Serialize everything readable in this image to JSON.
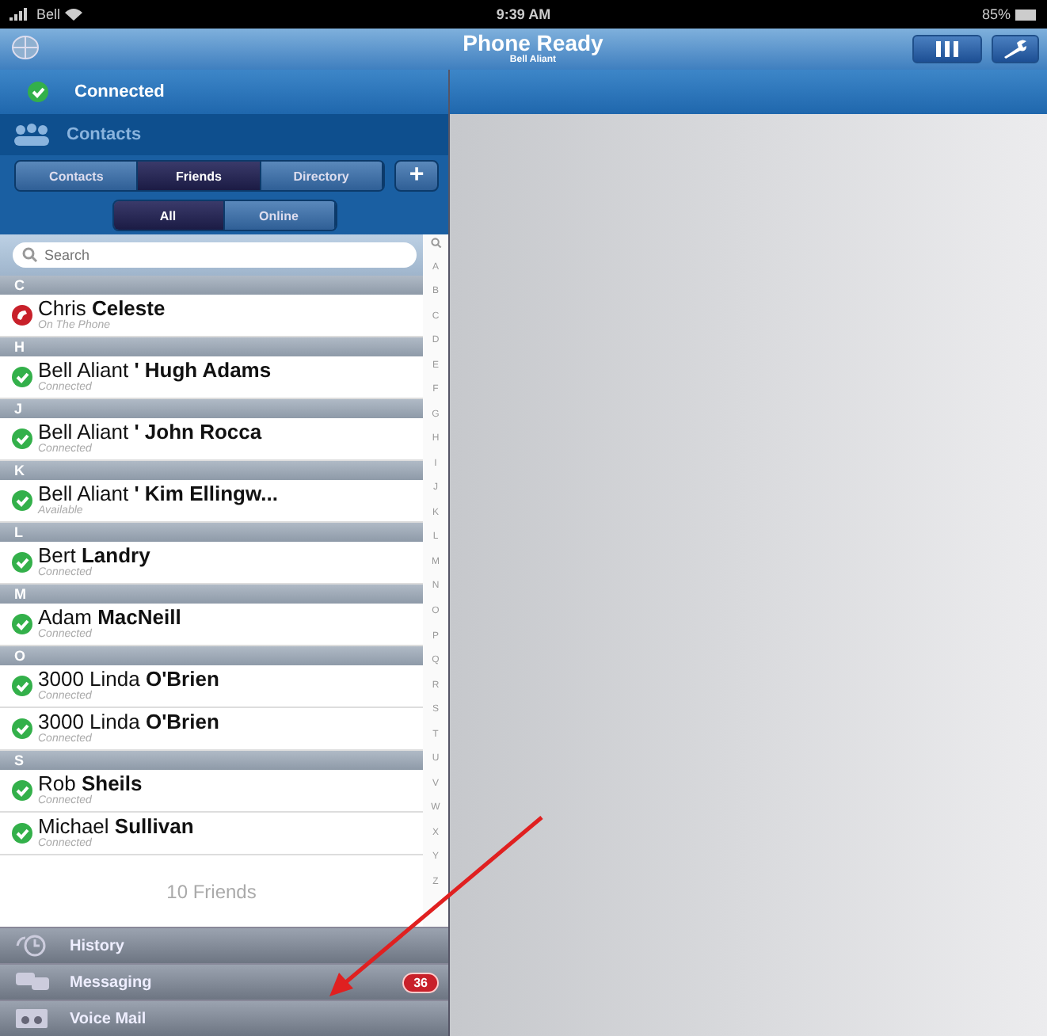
{
  "status_bar": {
    "carrier": "Bell",
    "time": "9:39 AM",
    "battery": "85%"
  },
  "nav_bar": {
    "title": "Phone Ready",
    "subtitle": "Bell Aliant"
  },
  "connection": {
    "label": "Connected"
  },
  "contacts_header": {
    "label": "Contacts"
  },
  "tabs": [
    {
      "label": "Contacts",
      "selected": false
    },
    {
      "label": "Friends",
      "selected": true
    },
    {
      "label": "Directory",
      "selected": false
    }
  ],
  "add_button": {
    "label": "+"
  },
  "filters": [
    {
      "label": "All",
      "selected": true
    },
    {
      "label": "Online",
      "selected": false
    }
  ],
  "search": {
    "placeholder": "Search"
  },
  "sections": [
    {
      "letter": "C",
      "contacts": [
        {
          "first": "Chris",
          "last": "Celeste",
          "status": "On The Phone",
          "kind": "busy"
        }
      ]
    },
    {
      "letter": "H",
      "contacts": [
        {
          "first": "Bell Aliant",
          "last": "' Hugh Adams",
          "status": "Connected",
          "kind": "online"
        }
      ]
    },
    {
      "letter": "J",
      "contacts": [
        {
          "first": "Bell Aliant",
          "last": "' John Rocca",
          "status": "Connected",
          "kind": "online"
        }
      ]
    },
    {
      "letter": "K",
      "contacts": [
        {
          "first": "Bell Aliant",
          "last": "' Kim Ellingw...",
          "status": "Available",
          "kind": "online"
        }
      ]
    },
    {
      "letter": "L",
      "contacts": [
        {
          "first": "Bert",
          "last": "Landry",
          "status": "Connected",
          "kind": "online"
        }
      ]
    },
    {
      "letter": "M",
      "contacts": [
        {
          "first": "Adam",
          "last": "MacNeill",
          "status": "Connected",
          "kind": "online"
        }
      ]
    },
    {
      "letter": "O",
      "contacts": [
        {
          "first": "3000 Linda",
          "last": "O'Brien",
          "status": "Connected",
          "kind": "online"
        },
        {
          "first": "3000 Linda",
          "last": "O'Brien",
          "status": "Connected",
          "kind": "online"
        }
      ]
    },
    {
      "letter": "S",
      "contacts": [
        {
          "first": "Rob",
          "last": "Sheils",
          "status": "Connected",
          "kind": "online"
        },
        {
          "first": "Michael",
          "last": "Sullivan",
          "status": "Connected",
          "kind": "online"
        }
      ]
    }
  ],
  "index": [
    "A",
    "B",
    "C",
    "D",
    "E",
    "F",
    "G",
    "H",
    "I",
    "J",
    "K",
    "L",
    "M",
    "N",
    "O",
    "P",
    "Q",
    "R",
    "S",
    "T",
    "U",
    "V",
    "W",
    "X",
    "Y",
    "Z"
  ],
  "footer": "10 Friends",
  "bottom_items": [
    {
      "label": "History",
      "kind": "history"
    },
    {
      "label": "Messaging",
      "kind": "messaging",
      "badge": "36"
    },
    {
      "label": "Voice Mail",
      "kind": "voicemail"
    }
  ]
}
